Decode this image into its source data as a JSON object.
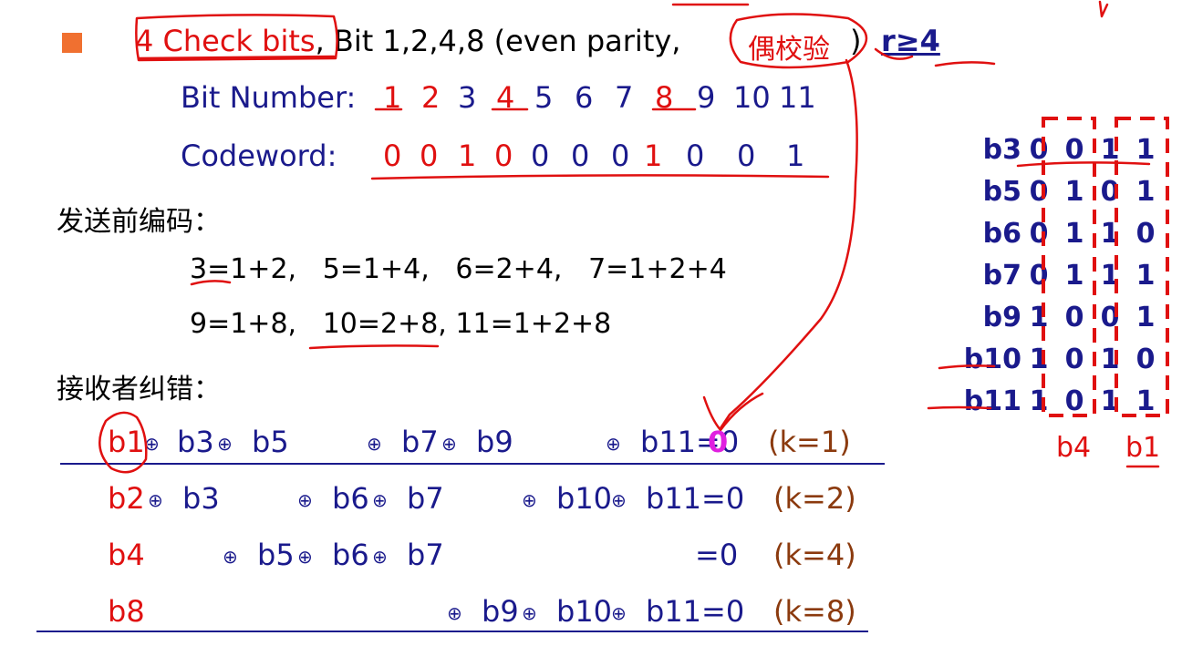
{
  "header": {
    "check_bits": "4 Check bits",
    "rest": ", Bit 1,2,4,8 (even parity,",
    "cn": "偶校验",
    "close": ")",
    "r_label": "r≥4"
  },
  "bit_number": {
    "label": "Bit Number:",
    "values": [
      "1",
      "2",
      "3",
      "4",
      "5",
      "6",
      "7",
      "8",
      "9",
      "10",
      "11"
    ]
  },
  "codeword": {
    "label": "Codeword:",
    "values": [
      "0",
      "0",
      "1",
      "0",
      "0",
      "0",
      "0",
      "1",
      "0",
      "0",
      "1"
    ]
  },
  "encode": {
    "title": "发送前编码：",
    "line1": [
      "3=1+2,",
      "5=1+4,",
      "6=2+4,",
      "7=1+2+4"
    ],
    "line2": [
      "9=1+8,",
      "10=2+8,",
      "11=1+2+8"
    ]
  },
  "decode": {
    "title": "接收者纠错：",
    "xor": "⊕",
    "rows": [
      {
        "lead": "b1",
        "terms": [
          "b3",
          "b5",
          "b7",
          "b9",
          "b11=0"
        ],
        "k": "(k=1)",
        "result": "0"
      },
      {
        "lead": "b2",
        "terms": [
          "b3",
          "b6",
          "b7",
          "b10",
          "b11=0"
        ],
        "k": "(k=2)"
      },
      {
        "lead": "b4",
        "terms": [
          "b5",
          "b6",
          "b7",
          "=0"
        ],
        "k": "(k=4)"
      },
      {
        "lead": "b8",
        "terms": [
          "b9",
          "b10",
          "b11=0"
        ],
        "k": "(k=8)"
      }
    ]
  },
  "table": {
    "rows": [
      {
        "label": "b3",
        "bits": [
          "0",
          "0",
          "1",
          "1"
        ]
      },
      {
        "label": "b5",
        "bits": [
          "0",
          "1",
          "0",
          "1"
        ]
      },
      {
        "label": "b6",
        "bits": [
          "0",
          "1",
          "1",
          "0"
        ]
      },
      {
        "label": "b7",
        "bits": [
          "0",
          "1",
          "1",
          "1"
        ]
      },
      {
        "label": "b9",
        "bits": [
          "1",
          "0",
          "0",
          "1"
        ]
      },
      {
        "label": "b10",
        "bits": [
          "1",
          "0",
          "1",
          "0"
        ]
      },
      {
        "label": "b11",
        "bits": [
          "1",
          "0",
          "1",
          "1"
        ]
      }
    ],
    "col_b4": "b4",
    "col_b1": "b1"
  },
  "colors": {
    "text_blue": "#1a1a8c",
    "ink_red": "#e01010",
    "brown": "#8b3a0e",
    "bullet": "#f07030",
    "magenta": "#e020e0"
  }
}
